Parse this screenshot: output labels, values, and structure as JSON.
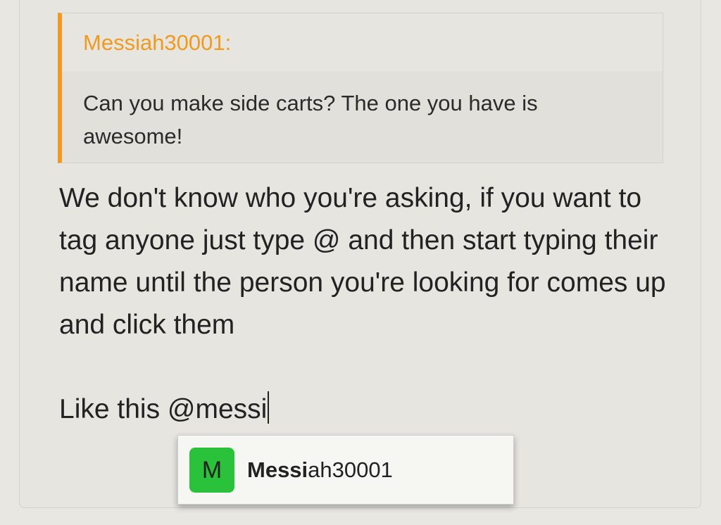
{
  "quote": {
    "author": "Messiah30001:",
    "text": "Can you make side carts? The one you have is awesome!"
  },
  "message": {
    "body": "We don't know who you're asking, if you want to tag anyone just type @ and then start typing their name until the person you're looking for comes up and click them",
    "typed_line": "Like this @messi"
  },
  "mention_suggestions": [
    {
      "avatar_letter": "M",
      "name_match": "Messi",
      "name_rest": "ah30001",
      "avatar_color": "#2ac23a"
    }
  ],
  "colors": {
    "quote_accent": "#f29a1f",
    "avatar": "#2ac23a"
  }
}
